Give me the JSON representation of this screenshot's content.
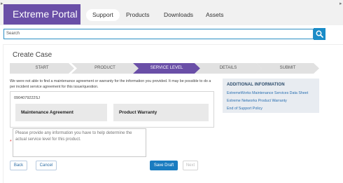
{
  "header": {
    "logo": "Extreme Portal",
    "nav": [
      "Support",
      "Products",
      "Downloads",
      "Assets"
    ],
    "active_nav": "Support"
  },
  "search": {
    "placeholder": "Search"
  },
  "page": {
    "title": "Create Case"
  },
  "steps": [
    {
      "label": "START",
      "active": false
    },
    {
      "label": "PRODUCT",
      "active": false
    },
    {
      "label": "SERVICE LEVEL",
      "active": true
    },
    {
      "label": "DETAILS",
      "active": false
    },
    {
      "label": "SUBMIT",
      "active": false
    }
  ],
  "notice": "We were not able to find a maintenance agreement or warranty for the information you provided. It may be possible to do a per incident service agreement for this issue/question.",
  "contract": {
    "id": "0904079222SJ",
    "options": [
      "Maintenance Agreement",
      "Product Warranty"
    ]
  },
  "description": {
    "required_mark": "*",
    "placeholder": "Please provide any information you have to help determine the actual service level for this product."
  },
  "buttons": {
    "back": "Back",
    "cancel": "Cancel",
    "save_draft": "Save Draft",
    "next": "Next"
  },
  "sidebar": {
    "title": "ADDITIONAL INFORMATION",
    "links": [
      "ExtremeWorks Maintenance Services Data Sheet",
      "Extreme Networks Product Warranty",
      "End of Support Policy"
    ]
  },
  "colors": {
    "brand": "#6a4fa7",
    "accent": "#1a8cc8",
    "step_inactive": "#e1e1e1"
  },
  "icons": {
    "search": "search-icon"
  }
}
